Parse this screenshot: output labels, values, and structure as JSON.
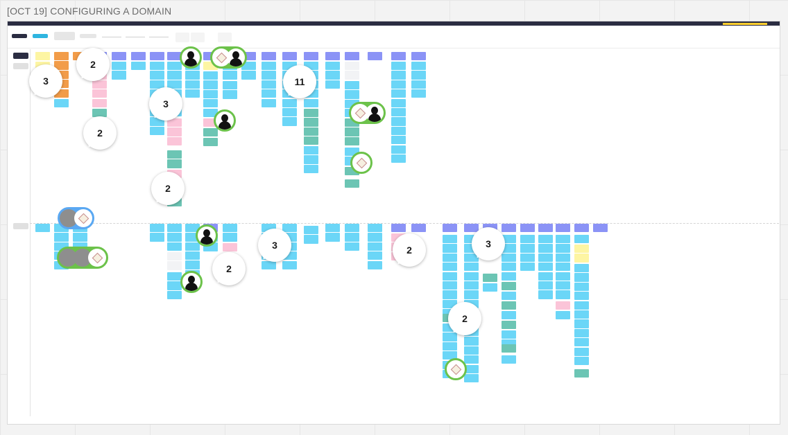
{
  "frame": {
    "title": "[OCT 19] CONFIGURING A DOMAIN"
  },
  "board": {
    "accent_color": "#ffd02f",
    "bar_color": "#2b2d42"
  },
  "colors": {
    "purple": "#8b93f6",
    "blue": "#6bd6f7",
    "teal": "#6cc5b4",
    "pink": "#fbc4d8",
    "orange": "#f29c49",
    "yellow": "#fdf5a3",
    "avatar_ring": "#6cc24a",
    "avatar_ring_alt": "#5aa8f2"
  },
  "comment_counts": [
    {
      "id": "c1",
      "count": "3"
    },
    {
      "id": "c2",
      "count": "2"
    },
    {
      "id": "c3",
      "count": "3"
    },
    {
      "id": "c4",
      "count": "2"
    },
    {
      "id": "c5",
      "count": "2"
    },
    {
      "id": "c6",
      "count": "11"
    },
    {
      "id": "c7",
      "count": "3"
    },
    {
      "id": "c8",
      "count": "2"
    },
    {
      "id": "c9",
      "count": "2"
    },
    {
      "id": "c10",
      "count": "3"
    },
    {
      "id": "c11",
      "count": "2"
    }
  ],
  "icons": {
    "avatar": "user-avatar-icon",
    "diamond": "diamond-logo-icon",
    "comment": "comment-bubble-icon"
  }
}
